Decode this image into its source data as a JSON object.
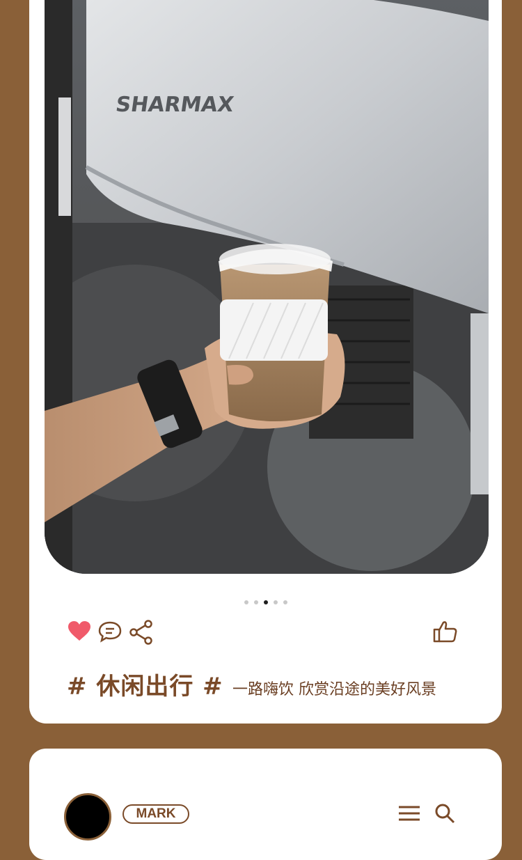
{
  "post": {
    "image": {
      "subject": "hand holding coffee cup in front of motorcycle",
      "brand_text": "SHARMAX"
    },
    "carousel": {
      "count": 5,
      "active_index": 2
    },
    "actions": {
      "like_icon": "heart-icon",
      "comment_icon": "comment-icon",
      "share_icon": "share-icon",
      "thumb_icon": "thumbs-up-icon",
      "liked_color": "#f05a6a"
    },
    "hashtag": "# 休闲出行 #",
    "caption": "一路嗨饮 欣赏沿途的美好风景"
  },
  "next_post": {
    "username": "MARK",
    "menu_icon": "menu-icon",
    "search_icon": "search-icon"
  },
  "colors": {
    "background": "#8a6038",
    "accent": "#7a4a28",
    "card": "#ffffff"
  }
}
